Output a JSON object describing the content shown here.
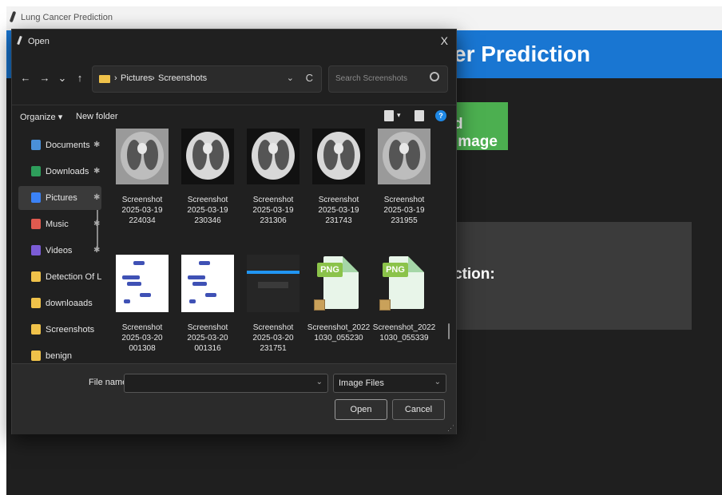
{
  "app": {
    "window_title": "Lung Cancer Prediction",
    "header_title_partial": "er Prediction",
    "upload_button_partial": "d Image",
    "prediction_label_partial": "ction:"
  },
  "dialog": {
    "title": "Open",
    "close_glyph": "X",
    "nav": {
      "back": "←",
      "forward": "→",
      "recent": "⌄",
      "up": "↑"
    },
    "breadcrumb": [
      "Pictures",
      "Screenshots"
    ],
    "breadcrumb_sep": "›",
    "search_placeholder": "Search Screenshots",
    "commands": {
      "organize": "Organize ▾",
      "new_folder": "New folder"
    },
    "sidebar": [
      {
        "label": "Documents",
        "pinned": true,
        "icon": "documents-icon",
        "color": "#4a90d9"
      },
      {
        "label": "Downloads",
        "pinned": true,
        "icon": "downloads-icon",
        "color": "#2e9e5b"
      },
      {
        "label": "Pictures",
        "pinned": true,
        "icon": "pictures-icon",
        "color": "#3b82f6",
        "selected": true
      },
      {
        "label": "Music",
        "pinned": true,
        "icon": "music-icon",
        "color": "#e05a4f"
      },
      {
        "label": "Videos",
        "pinned": true,
        "icon": "videos-icon",
        "color": "#7b5cd6"
      },
      {
        "label": "Detection Of Lu",
        "pinned": false,
        "icon": "folder-icon",
        "color": "#f0c24a"
      },
      {
        "label": "downloaads",
        "pinned": false,
        "icon": "folder-icon",
        "color": "#f0c24a"
      },
      {
        "label": "Screenshots",
        "pinned": false,
        "icon": "folder-icon",
        "color": "#f0c24a"
      },
      {
        "label": "benign",
        "pinned": false,
        "icon": "folder-icon",
        "color": "#f0c24a"
      }
    ],
    "pin_glyph": "✱",
    "files": [
      {
        "name": [
          "Screenshot",
          "2025-03-19",
          "224034"
        ],
        "kind": "ct-light"
      },
      {
        "name": [
          "Screenshot",
          "2025-03-19",
          "230346"
        ],
        "kind": "ct"
      },
      {
        "name": [
          "Screenshot",
          "2025-03-19",
          "231306"
        ],
        "kind": "ct"
      },
      {
        "name": [
          "Screenshot",
          "2025-03-19",
          "231743"
        ],
        "kind": "ct"
      },
      {
        "name": [
          "Screenshot",
          "2025-03-19",
          "231955"
        ],
        "kind": "ct-light"
      },
      {
        "name": [
          "Screenshot",
          "2025-03-20",
          "001308"
        ],
        "kind": "diagram"
      },
      {
        "name": [
          "Screenshot",
          "2025-03-20",
          "001316"
        ],
        "kind": "diagram"
      },
      {
        "name": [
          "Screenshot",
          "2025-03-20",
          "231751"
        ],
        "kind": "dark"
      },
      {
        "name": [
          "Screenshot_2022",
          "1030_055230"
        ],
        "kind": "png"
      },
      {
        "name": [
          "Screenshot_2022",
          "1030_055339"
        ],
        "kind": "png"
      }
    ],
    "png_tag": "PNG",
    "file_name_label": "File name:",
    "file_name_value": "",
    "filter_value": "Image Files",
    "open_label": "Open",
    "cancel_label": "Cancel",
    "dropdown_glyph": "⌄",
    "refresh_glyph": "C"
  }
}
